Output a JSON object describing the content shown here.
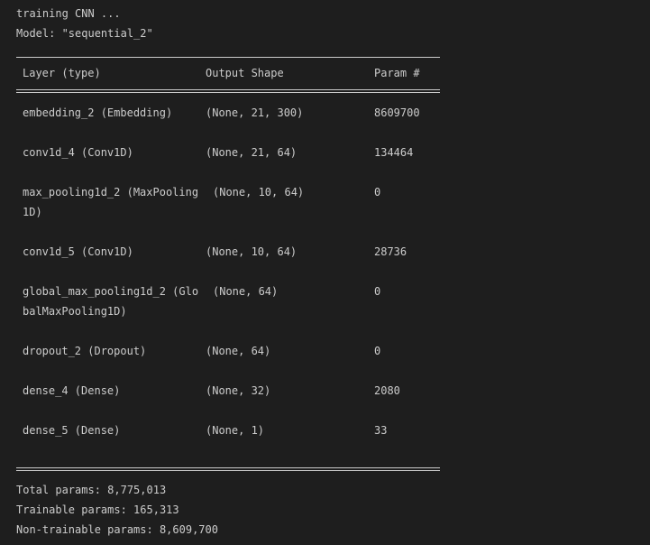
{
  "header": {
    "line1": "training CNN ...",
    "line2": "Model: \"sequential_2\""
  },
  "table": {
    "columns": [
      "Layer (type)",
      "Output Shape",
      "Param #"
    ],
    "rows": [
      {
        "layer": "embedding_2 (Embedding)",
        "layer2": "",
        "shape": "(None, 21, 300)",
        "params": "8609700"
      },
      {
        "layer": "conv1d_4 (Conv1D)",
        "layer2": "",
        "shape": "(None, 21, 64)",
        "params": "134464"
      },
      {
        "layer": "max_pooling1d_2 (MaxPooling",
        "layer2": "1D)",
        "shape": "(None, 10, 64)",
        "params": "0"
      },
      {
        "layer": "conv1d_5 (Conv1D)",
        "layer2": "",
        "shape": "(None, 10, 64)",
        "params": "28736"
      },
      {
        "layer": "global_max_pooling1d_2 (Glo",
        "layer2": "balMaxPooling1D)",
        "shape": "(None, 64)",
        "params": "0"
      },
      {
        "layer": "dropout_2 (Dropout)",
        "layer2": "",
        "shape": "(None, 64)",
        "params": "0"
      },
      {
        "layer": "dense_4 (Dense)",
        "layer2": "",
        "shape": "(None, 32)",
        "params": "2080"
      },
      {
        "layer": "dense_5 (Dense)",
        "layer2": "",
        "shape": "(None, 1)",
        "params": "33"
      }
    ]
  },
  "summary": {
    "total": "Total params: 8,775,013",
    "trainable": "Trainable params: 165,313",
    "non_trainable": "Non-trainable params: 8,609,700"
  }
}
